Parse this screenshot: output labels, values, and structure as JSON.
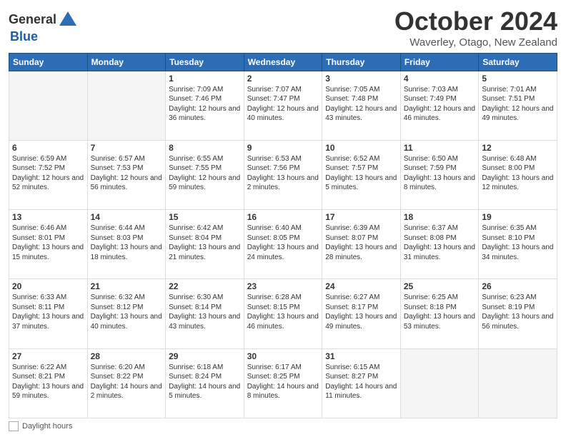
{
  "header": {
    "logo_general": "General",
    "logo_blue": "Blue",
    "month_title": "October 2024",
    "location": "Waverley, Otago, New Zealand"
  },
  "days_of_week": [
    "Sunday",
    "Monday",
    "Tuesday",
    "Wednesday",
    "Thursday",
    "Friday",
    "Saturday"
  ],
  "weeks": [
    [
      {
        "day": "",
        "info": ""
      },
      {
        "day": "",
        "info": ""
      },
      {
        "day": "1",
        "info": "Sunrise: 7:09 AM\nSunset: 7:46 PM\nDaylight: 12 hours and 36 minutes."
      },
      {
        "day": "2",
        "info": "Sunrise: 7:07 AM\nSunset: 7:47 PM\nDaylight: 12 hours and 40 minutes."
      },
      {
        "day": "3",
        "info": "Sunrise: 7:05 AM\nSunset: 7:48 PM\nDaylight: 12 hours and 43 minutes."
      },
      {
        "day": "4",
        "info": "Sunrise: 7:03 AM\nSunset: 7:49 PM\nDaylight: 12 hours and 46 minutes."
      },
      {
        "day": "5",
        "info": "Sunrise: 7:01 AM\nSunset: 7:51 PM\nDaylight: 12 hours and 49 minutes."
      }
    ],
    [
      {
        "day": "6",
        "info": "Sunrise: 6:59 AM\nSunset: 7:52 PM\nDaylight: 12 hours and 52 minutes."
      },
      {
        "day": "7",
        "info": "Sunrise: 6:57 AM\nSunset: 7:53 PM\nDaylight: 12 hours and 56 minutes."
      },
      {
        "day": "8",
        "info": "Sunrise: 6:55 AM\nSunset: 7:55 PM\nDaylight: 12 hours and 59 minutes."
      },
      {
        "day": "9",
        "info": "Sunrise: 6:53 AM\nSunset: 7:56 PM\nDaylight: 13 hours and 2 minutes."
      },
      {
        "day": "10",
        "info": "Sunrise: 6:52 AM\nSunset: 7:57 PM\nDaylight: 13 hours and 5 minutes."
      },
      {
        "day": "11",
        "info": "Sunrise: 6:50 AM\nSunset: 7:59 PM\nDaylight: 13 hours and 8 minutes."
      },
      {
        "day": "12",
        "info": "Sunrise: 6:48 AM\nSunset: 8:00 PM\nDaylight: 13 hours and 12 minutes."
      }
    ],
    [
      {
        "day": "13",
        "info": "Sunrise: 6:46 AM\nSunset: 8:01 PM\nDaylight: 13 hours and 15 minutes."
      },
      {
        "day": "14",
        "info": "Sunrise: 6:44 AM\nSunset: 8:03 PM\nDaylight: 13 hours and 18 minutes."
      },
      {
        "day": "15",
        "info": "Sunrise: 6:42 AM\nSunset: 8:04 PM\nDaylight: 13 hours and 21 minutes."
      },
      {
        "day": "16",
        "info": "Sunrise: 6:40 AM\nSunset: 8:05 PM\nDaylight: 13 hours and 24 minutes."
      },
      {
        "day": "17",
        "info": "Sunrise: 6:39 AM\nSunset: 8:07 PM\nDaylight: 13 hours and 28 minutes."
      },
      {
        "day": "18",
        "info": "Sunrise: 6:37 AM\nSunset: 8:08 PM\nDaylight: 13 hours and 31 minutes."
      },
      {
        "day": "19",
        "info": "Sunrise: 6:35 AM\nSunset: 8:10 PM\nDaylight: 13 hours and 34 minutes."
      }
    ],
    [
      {
        "day": "20",
        "info": "Sunrise: 6:33 AM\nSunset: 8:11 PM\nDaylight: 13 hours and 37 minutes."
      },
      {
        "day": "21",
        "info": "Sunrise: 6:32 AM\nSunset: 8:12 PM\nDaylight: 13 hours and 40 minutes."
      },
      {
        "day": "22",
        "info": "Sunrise: 6:30 AM\nSunset: 8:14 PM\nDaylight: 13 hours and 43 minutes."
      },
      {
        "day": "23",
        "info": "Sunrise: 6:28 AM\nSunset: 8:15 PM\nDaylight: 13 hours and 46 minutes."
      },
      {
        "day": "24",
        "info": "Sunrise: 6:27 AM\nSunset: 8:17 PM\nDaylight: 13 hours and 49 minutes."
      },
      {
        "day": "25",
        "info": "Sunrise: 6:25 AM\nSunset: 8:18 PM\nDaylight: 13 hours and 53 minutes."
      },
      {
        "day": "26",
        "info": "Sunrise: 6:23 AM\nSunset: 8:19 PM\nDaylight: 13 hours and 56 minutes."
      }
    ],
    [
      {
        "day": "27",
        "info": "Sunrise: 6:22 AM\nSunset: 8:21 PM\nDaylight: 13 hours and 59 minutes."
      },
      {
        "day": "28",
        "info": "Sunrise: 6:20 AM\nSunset: 8:22 PM\nDaylight: 14 hours and 2 minutes."
      },
      {
        "day": "29",
        "info": "Sunrise: 6:18 AM\nSunset: 8:24 PM\nDaylight: 14 hours and 5 minutes."
      },
      {
        "day": "30",
        "info": "Sunrise: 6:17 AM\nSunset: 8:25 PM\nDaylight: 14 hours and 8 minutes."
      },
      {
        "day": "31",
        "info": "Sunrise: 6:15 AM\nSunset: 8:27 PM\nDaylight: 14 hours and 11 minutes."
      },
      {
        "day": "",
        "info": ""
      },
      {
        "day": "",
        "info": ""
      }
    ]
  ],
  "footer": {
    "daylight_hours_label": "Daylight hours"
  }
}
